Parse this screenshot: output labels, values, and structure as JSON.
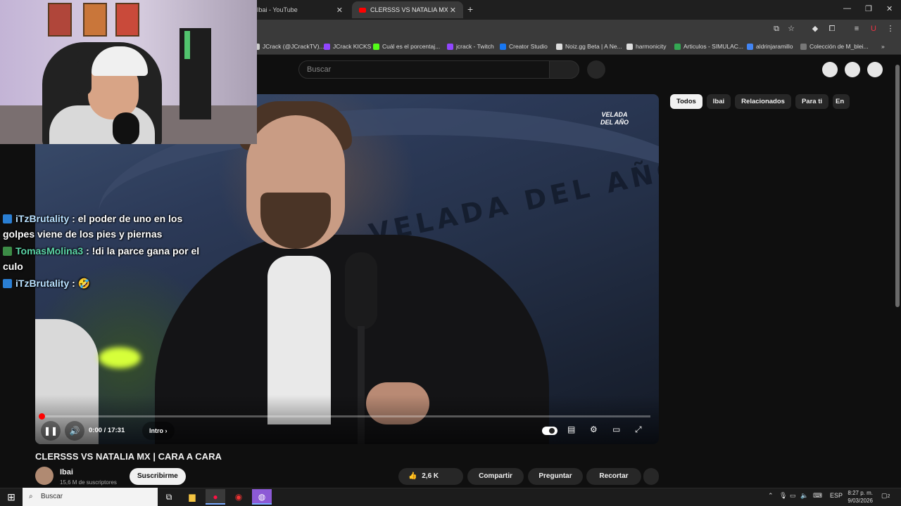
{
  "browser": {
    "tabs": [
      {
        "label": "Ibai - YouTube",
        "active": false
      },
      {
        "label": "CLERSSS VS NATALIA MX | CAR",
        "active": true
      }
    ],
    "bookmarks": [
      {
        "label": "JCrack (@JCrackTV)...",
        "color": "#cccccc"
      },
      {
        "label": "JCrack KICKS",
        "color": "#9146ff"
      },
      {
        "label": "Cuál es el porcentaj...",
        "color": "#53fc18"
      },
      {
        "label": "jcrack - Twitch",
        "color": "#9146ff"
      },
      {
        "label": "Creator Studio",
        "color": "#1877f2"
      },
      {
        "label": "Noiz.gg Beta | A Ne...",
        "color": "#dddddd"
      },
      {
        "label": "harmonicity",
        "color": "#dddddd"
      },
      {
        "label": "Articulos - SIMULAC...",
        "color": "#34a853"
      },
      {
        "label": "aldrinjaramillo",
        "color": "#4285f4"
      },
      {
        "label": "Colección de M_blei...",
        "color": "#777777"
      }
    ]
  },
  "youtube": {
    "search_placeholder": "Buscar",
    "chips": [
      "Todos",
      "Ibai",
      "Relacionados",
      "Para ti",
      "En"
    ],
    "video": {
      "time": "0:00 / 17:31",
      "chapter": "Intro",
      "progress": 0,
      "scene_text": "VELADA DEL AÑO",
      "logo_text": "VELADA DEL AÑO"
    },
    "title": "CLERSSS VS NATALIA MX | CARA A CARA",
    "channel": {
      "name": "Ibai",
      "subs": "15,6 M de suscriptores"
    },
    "subscribe_label": "Suscribirme",
    "likes": "2,6 K",
    "share_label": "Compartir",
    "ask_label": "Preguntar",
    "clip_label": "Recortar"
  },
  "chat": [
    {
      "user": "iTzBrutality",
      "text": ": el poder de uno en los golpes viene de los pies y piernas",
      "color": "#b9e1ff"
    },
    {
      "user": "TomasMolina3",
      "text": ": !di la parce gana por el culo",
      "color": "#5cd6a8"
    },
    {
      "user": "iTzBrutality",
      "text": ": 🤣",
      "color": "#b9e1ff"
    }
  ],
  "taskbar": {
    "search_placeholder": "Buscar",
    "lang": "ESP",
    "time": "8:27 p. m.",
    "date": "9/03/2026",
    "notifications": "2"
  }
}
